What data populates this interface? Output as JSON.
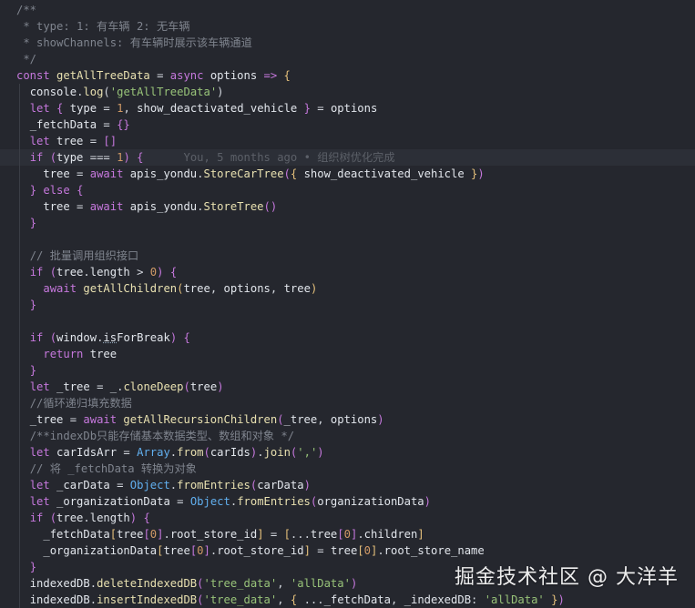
{
  "colors": {
    "background": "#25272e",
    "keyword": "#c678dd",
    "string": "#98c379",
    "number": "#d19a66",
    "comment": "#7f848e",
    "function": "#e8e0b0",
    "builtin": "#61afef"
  },
  "lines": [
    [
      [
        "cm",
        "/**"
      ]
    ],
    [
      [
        "cm",
        " * type: 1: 有车辆 2: 无车辆"
      ]
    ],
    [
      [
        "cm",
        " * showChannels: 有车辆时展示该车辆通道"
      ]
    ],
    [
      [
        "cm",
        " */"
      ]
    ],
    [
      [
        "kw",
        "const "
      ],
      [
        "fn",
        "getAllTreeData"
      ],
      [
        "punc",
        " = "
      ],
      [
        "kw",
        "async "
      ],
      [
        "var",
        "options "
      ],
      [
        "kw",
        "=> "
      ],
      [
        "brace",
        "{"
      ]
    ],
    [
      [
        "punc",
        "  "
      ],
      [
        "var",
        "console"
      ],
      [
        "punc",
        "."
      ],
      [
        "fn",
        "log"
      ],
      [
        "punc",
        "("
      ],
      [
        "str",
        "'getAllTreeData'"
      ],
      [
        "punc",
        ")"
      ]
    ],
    [
      [
        "punc",
        "  "
      ],
      [
        "kw",
        "let "
      ],
      [
        "brace2",
        "{ "
      ],
      [
        "var",
        "type"
      ],
      [
        "punc",
        " = "
      ],
      [
        "num",
        "1"
      ],
      [
        "punc",
        ", "
      ],
      [
        "var",
        "show_deactivated_vehicle"
      ],
      [
        "brace2",
        " }"
      ],
      [
        "punc",
        " = "
      ],
      [
        "var",
        "options"
      ]
    ],
    [
      [
        "punc",
        "  "
      ],
      [
        "var",
        "_fetchData"
      ],
      [
        "punc",
        " = "
      ],
      [
        "brace2",
        "{}"
      ]
    ],
    [
      [
        "punc",
        "  "
      ],
      [
        "kw",
        "let "
      ],
      [
        "var",
        "tree"
      ],
      [
        "punc",
        " = "
      ],
      [
        "brace2",
        "[]"
      ]
    ],
    [
      [
        "punc",
        "  "
      ],
      [
        "kw",
        "if "
      ],
      [
        "brace2",
        "("
      ],
      [
        "var",
        "type"
      ],
      [
        "punc",
        " === "
      ],
      [
        "num",
        "1"
      ],
      [
        "brace2",
        ")"
      ],
      [
        "punc",
        " "
      ],
      [
        "brace2",
        "{"
      ],
      [
        "blame",
        "      You, 5 months ago • 组织树优化完成"
      ]
    ],
    [
      [
        "punc",
        "    "
      ],
      [
        "var",
        "tree"
      ],
      [
        "punc",
        " = "
      ],
      [
        "kw",
        "await "
      ],
      [
        "var",
        "apis_yondu"
      ],
      [
        "punc",
        "."
      ],
      [
        "fn",
        "StoreCarTree"
      ],
      [
        "brace2",
        "("
      ],
      [
        "brace",
        "{ "
      ],
      [
        "var",
        "show_deactivated_vehicle"
      ],
      [
        "brace",
        " }"
      ],
      [
        "brace2",
        ")"
      ]
    ],
    [
      [
        "punc",
        "  "
      ],
      [
        "brace2",
        "}"
      ],
      [
        "kw",
        " else "
      ],
      [
        "brace2",
        "{"
      ]
    ],
    [
      [
        "punc",
        "    "
      ],
      [
        "var",
        "tree"
      ],
      [
        "punc",
        " = "
      ],
      [
        "kw",
        "await "
      ],
      [
        "var",
        "apis_yondu"
      ],
      [
        "punc",
        "."
      ],
      [
        "fn",
        "StoreTree"
      ],
      [
        "brace2",
        "()"
      ]
    ],
    [
      [
        "punc",
        "  "
      ],
      [
        "brace2",
        "}"
      ]
    ],
    [
      [
        "punc",
        ""
      ]
    ],
    [
      [
        "punc",
        "  "
      ],
      [
        "cm",
        "// 批量调用组织接口"
      ]
    ],
    [
      [
        "punc",
        "  "
      ],
      [
        "kw",
        "if "
      ],
      [
        "brace2",
        "("
      ],
      [
        "var",
        "tree"
      ],
      [
        "punc",
        "."
      ],
      [
        "var",
        "length"
      ],
      [
        "punc",
        " > "
      ],
      [
        "num",
        "0"
      ],
      [
        "brace2",
        ")"
      ],
      [
        "punc",
        " "
      ],
      [
        "brace2",
        "{"
      ]
    ],
    [
      [
        "punc",
        "    "
      ],
      [
        "kw",
        "await "
      ],
      [
        "fn",
        "getAllChildren"
      ],
      [
        "brace",
        "("
      ],
      [
        "var",
        "tree"
      ],
      [
        "punc",
        ", "
      ],
      [
        "var",
        "options"
      ],
      [
        "punc",
        ", "
      ],
      [
        "var",
        "tree"
      ],
      [
        "brace",
        ")"
      ]
    ],
    [
      [
        "punc",
        "  "
      ],
      [
        "brace2",
        "}"
      ]
    ],
    [
      [
        "punc",
        ""
      ]
    ],
    [
      [
        "punc",
        "  "
      ],
      [
        "kw",
        "if "
      ],
      [
        "brace2",
        "("
      ],
      [
        "var",
        "window"
      ],
      [
        "punc",
        "."
      ],
      [
        "var",
        "isForBreak"
      ],
      [
        "brace2",
        ")"
      ],
      [
        "punc",
        " "
      ],
      [
        "brace2",
        "{"
      ]
    ],
    [
      [
        "punc",
        "    "
      ],
      [
        "kw",
        "return "
      ],
      [
        "var",
        "tree"
      ]
    ],
    [
      [
        "punc",
        "  "
      ],
      [
        "brace2",
        "}"
      ]
    ],
    [
      [
        "punc",
        "  "
      ],
      [
        "kw",
        "let "
      ],
      [
        "var",
        "_tree"
      ],
      [
        "punc",
        " = "
      ],
      [
        "var",
        "_"
      ],
      [
        "punc",
        "."
      ],
      [
        "fn",
        "cloneDeep"
      ],
      [
        "brace2",
        "("
      ],
      [
        "var",
        "tree"
      ],
      [
        "brace2",
        ")"
      ]
    ],
    [
      [
        "punc",
        "  "
      ],
      [
        "cm",
        "//循环递归填充数据"
      ]
    ],
    [
      [
        "punc",
        "  "
      ],
      [
        "var",
        "_tree"
      ],
      [
        "punc",
        " = "
      ],
      [
        "kw",
        "await "
      ],
      [
        "fn",
        "getAllRecursionChildren"
      ],
      [
        "brace2",
        "("
      ],
      [
        "var",
        "_tree"
      ],
      [
        "punc",
        ", "
      ],
      [
        "var",
        "options"
      ],
      [
        "brace2",
        ")"
      ]
    ],
    [
      [
        "punc",
        "  "
      ],
      [
        "cm",
        "/**indexDb只能存储基本数据类型、数组和对象 */"
      ]
    ],
    [
      [
        "punc",
        "  "
      ],
      [
        "kw",
        "let "
      ],
      [
        "var",
        "carIdsArr"
      ],
      [
        "punc",
        " = "
      ],
      [
        "obj",
        "Array"
      ],
      [
        "punc",
        "."
      ],
      [
        "fn",
        "from"
      ],
      [
        "brace2",
        "("
      ],
      [
        "var",
        "carIds"
      ],
      [
        "brace2",
        ")"
      ],
      [
        "punc",
        "."
      ],
      [
        "fn",
        "join"
      ],
      [
        "brace2",
        "("
      ],
      [
        "str",
        "','"
      ],
      [
        "brace2",
        ")"
      ]
    ],
    [
      [
        "punc",
        "  "
      ],
      [
        "cm",
        "// 将 _fetchData 转换为对象"
      ]
    ],
    [
      [
        "punc",
        "  "
      ],
      [
        "kw",
        "let "
      ],
      [
        "var",
        "_carData"
      ],
      [
        "punc",
        " = "
      ],
      [
        "obj",
        "Object"
      ],
      [
        "punc",
        "."
      ],
      [
        "fn",
        "fromEntries"
      ],
      [
        "brace2",
        "("
      ],
      [
        "var",
        "carData"
      ],
      [
        "brace2",
        ")"
      ]
    ],
    [
      [
        "punc",
        "  "
      ],
      [
        "kw",
        "let "
      ],
      [
        "var",
        "_organizationData"
      ],
      [
        "punc",
        " = "
      ],
      [
        "obj",
        "Object"
      ],
      [
        "punc",
        "."
      ],
      [
        "fn",
        "fromEntries"
      ],
      [
        "brace2",
        "("
      ],
      [
        "var",
        "organizationData"
      ],
      [
        "brace2",
        ")"
      ]
    ],
    [
      [
        "punc",
        "  "
      ],
      [
        "kw",
        "if "
      ],
      [
        "brace2",
        "("
      ],
      [
        "var",
        "tree"
      ],
      [
        "punc",
        "."
      ],
      [
        "var",
        "length"
      ],
      [
        "brace2",
        ")"
      ],
      [
        "punc",
        " "
      ],
      [
        "brace2",
        "{"
      ]
    ],
    [
      [
        "punc",
        "    "
      ],
      [
        "var",
        "_fetchData"
      ],
      [
        "brace",
        "["
      ],
      [
        "var",
        "tree"
      ],
      [
        "brace2",
        "["
      ],
      [
        "num",
        "0"
      ],
      [
        "brace2",
        "]"
      ],
      [
        "punc",
        "."
      ],
      [
        "var",
        "root_store_id"
      ],
      [
        "brace",
        "]"
      ],
      [
        "punc",
        " = "
      ],
      [
        "brace",
        "["
      ],
      [
        "punc",
        "..."
      ],
      [
        "var",
        "tree"
      ],
      [
        "brace2",
        "["
      ],
      [
        "num",
        "0"
      ],
      [
        "brace2",
        "]"
      ],
      [
        "punc",
        "."
      ],
      [
        "var",
        "children"
      ],
      [
        "brace",
        "]"
      ]
    ],
    [
      [
        "punc",
        "    "
      ],
      [
        "var",
        "_organizationData"
      ],
      [
        "brace",
        "["
      ],
      [
        "var",
        "tree"
      ],
      [
        "brace2",
        "["
      ],
      [
        "num",
        "0"
      ],
      [
        "brace2",
        "]"
      ],
      [
        "punc",
        "."
      ],
      [
        "var",
        "root_store_id"
      ],
      [
        "brace",
        "]"
      ],
      [
        "punc",
        " = "
      ],
      [
        "var",
        "tree"
      ],
      [
        "brace",
        "["
      ],
      [
        "num",
        "0"
      ],
      [
        "brace",
        "]"
      ],
      [
        "punc",
        "."
      ],
      [
        "var",
        "root_store_name"
      ]
    ],
    [
      [
        "punc",
        "  "
      ],
      [
        "brace2",
        "}"
      ]
    ],
    [
      [
        "punc",
        "  "
      ],
      [
        "var",
        "indexedDB"
      ],
      [
        "punc",
        "."
      ],
      [
        "fn",
        "deleteIndexedDB"
      ],
      [
        "brace2",
        "("
      ],
      [
        "str",
        "'tree_data'"
      ],
      [
        "punc",
        ", "
      ],
      [
        "str",
        "'allData'"
      ],
      [
        "brace2",
        ")"
      ]
    ],
    [
      [
        "punc",
        "  "
      ],
      [
        "var",
        "indexedDB"
      ],
      [
        "punc",
        "."
      ],
      [
        "fn",
        "insertIndexedDB"
      ],
      [
        "brace2",
        "("
      ],
      [
        "str",
        "'tree_data'"
      ],
      [
        "punc",
        ", "
      ],
      [
        "brace",
        "{ "
      ],
      [
        "punc",
        "..."
      ],
      [
        "var",
        "_fetchData"
      ],
      [
        "punc",
        ", "
      ],
      [
        "var",
        "_indexedDB"
      ],
      [
        "punc",
        ": "
      ],
      [
        "str",
        "'allData'"
      ],
      [
        "brace",
        " }"
      ],
      [
        "brace2",
        ")"
      ]
    ]
  ],
  "cursor_line": 9,
  "underline": {
    "line": 20,
    "text": "is"
  },
  "watermark": "掘金技术社区 @ 大洋羊"
}
